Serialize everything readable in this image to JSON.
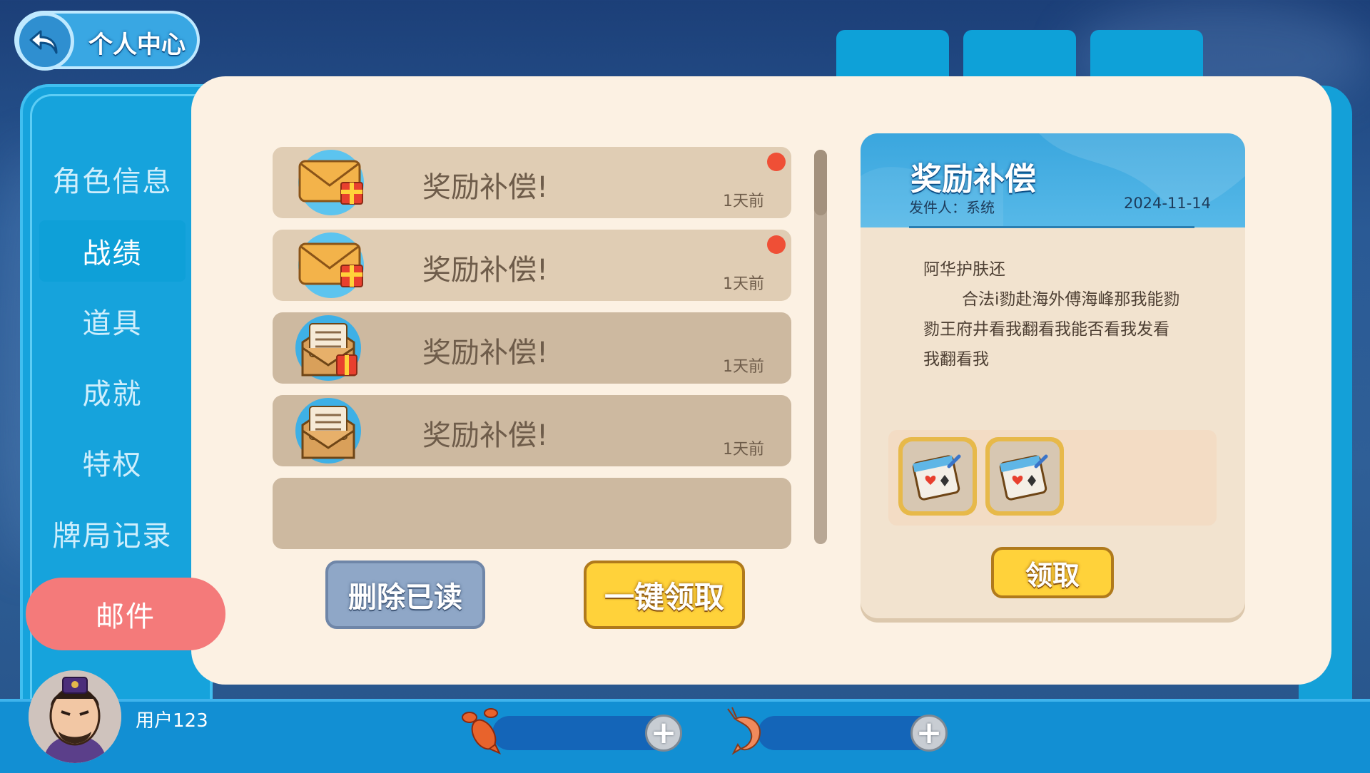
{
  "header": {
    "title": "个人中心"
  },
  "sidebar": {
    "items": [
      {
        "label": "角色信息"
      },
      {
        "label": "战绩"
      },
      {
        "label": "道具"
      },
      {
        "label": "成就"
      },
      {
        "label": "特权"
      },
      {
        "label": "牌局记录"
      }
    ],
    "mail_label": "邮件"
  },
  "mail_list": [
    {
      "title": "奖励补偿!",
      "time": "1天前",
      "unread": true
    },
    {
      "title": "奖励补偿!",
      "time": "1天前",
      "unread": true
    },
    {
      "title": "奖励补偿!",
      "time": "1天前",
      "unread": false
    },
    {
      "title": "奖励补偿!",
      "time": "1天前",
      "unread": false
    }
  ],
  "actions": {
    "delete_read": "删除已读",
    "claim_all": "一键领取"
  },
  "detail": {
    "title": "奖励补偿",
    "sender": "发件人：系统",
    "date": "2024-11-14",
    "body": [
      "阿华护肤还",
      "合法i勠赴海外傅海峰那我能勠",
      "勠王府井看我翻看我能否看我发看",
      "我翻看我"
    ],
    "claim": "领取"
  },
  "footer": {
    "username": "用户123"
  },
  "colors": {
    "accent": "#16a3dc",
    "mail_active": "#f47a7a",
    "claim": "#ffd23a",
    "unread_dot": "#ef4f36"
  }
}
